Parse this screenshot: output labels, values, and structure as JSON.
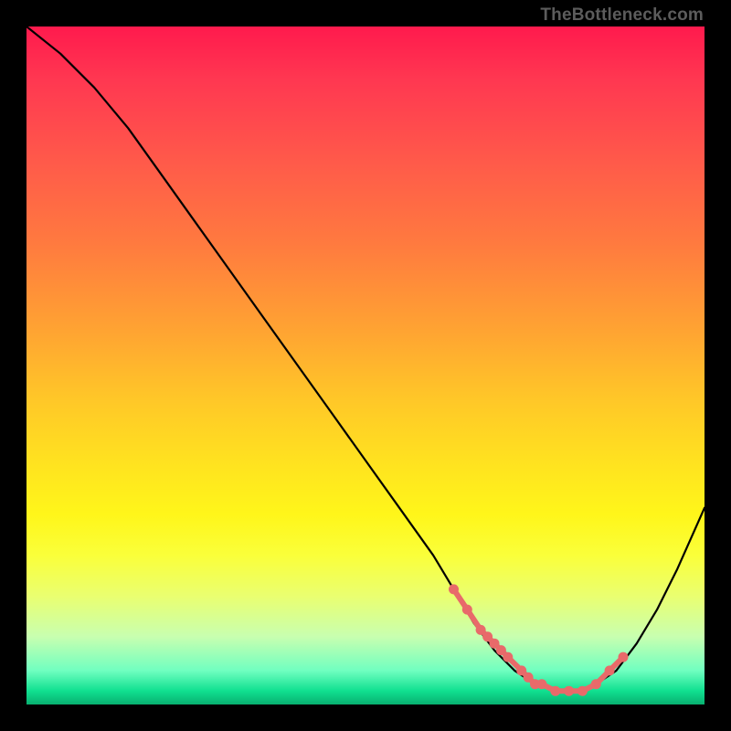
{
  "watermark": "TheBottleneck.com",
  "chart_data": {
    "type": "line",
    "title": "",
    "xlabel": "",
    "ylabel": "",
    "xlim": [
      0,
      100
    ],
    "ylim": [
      0,
      100
    ],
    "series": [
      {
        "name": "bottleneck-curve",
        "color": "#000000",
        "x": [
          0,
          5,
          10,
          15,
          20,
          25,
          30,
          35,
          40,
          45,
          50,
          55,
          60,
          63,
          66,
          69,
          72,
          75,
          78,
          81,
          84,
          87,
          90,
          93,
          96,
          100
        ],
        "y": [
          100,
          96,
          91,
          85,
          78,
          71,
          64,
          57,
          50,
          43,
          36,
          29,
          22,
          17,
          12,
          8,
          5,
          3,
          2,
          2,
          3,
          5,
          9,
          14,
          20,
          29
        ]
      }
    ],
    "markers": {
      "name": "highlight-points",
      "color": "#e86a6a",
      "x": [
        63,
        65,
        67,
        68,
        69,
        70,
        71,
        73,
        74,
        75,
        76,
        78,
        80,
        82,
        84,
        86,
        88
      ],
      "y": [
        17,
        14,
        11,
        10,
        9,
        8,
        7,
        5,
        4,
        3,
        3,
        2,
        2,
        2,
        3,
        5,
        7
      ]
    },
    "gradient_background": {
      "top": "#ff1a4d",
      "bottom": "#08b070"
    }
  }
}
